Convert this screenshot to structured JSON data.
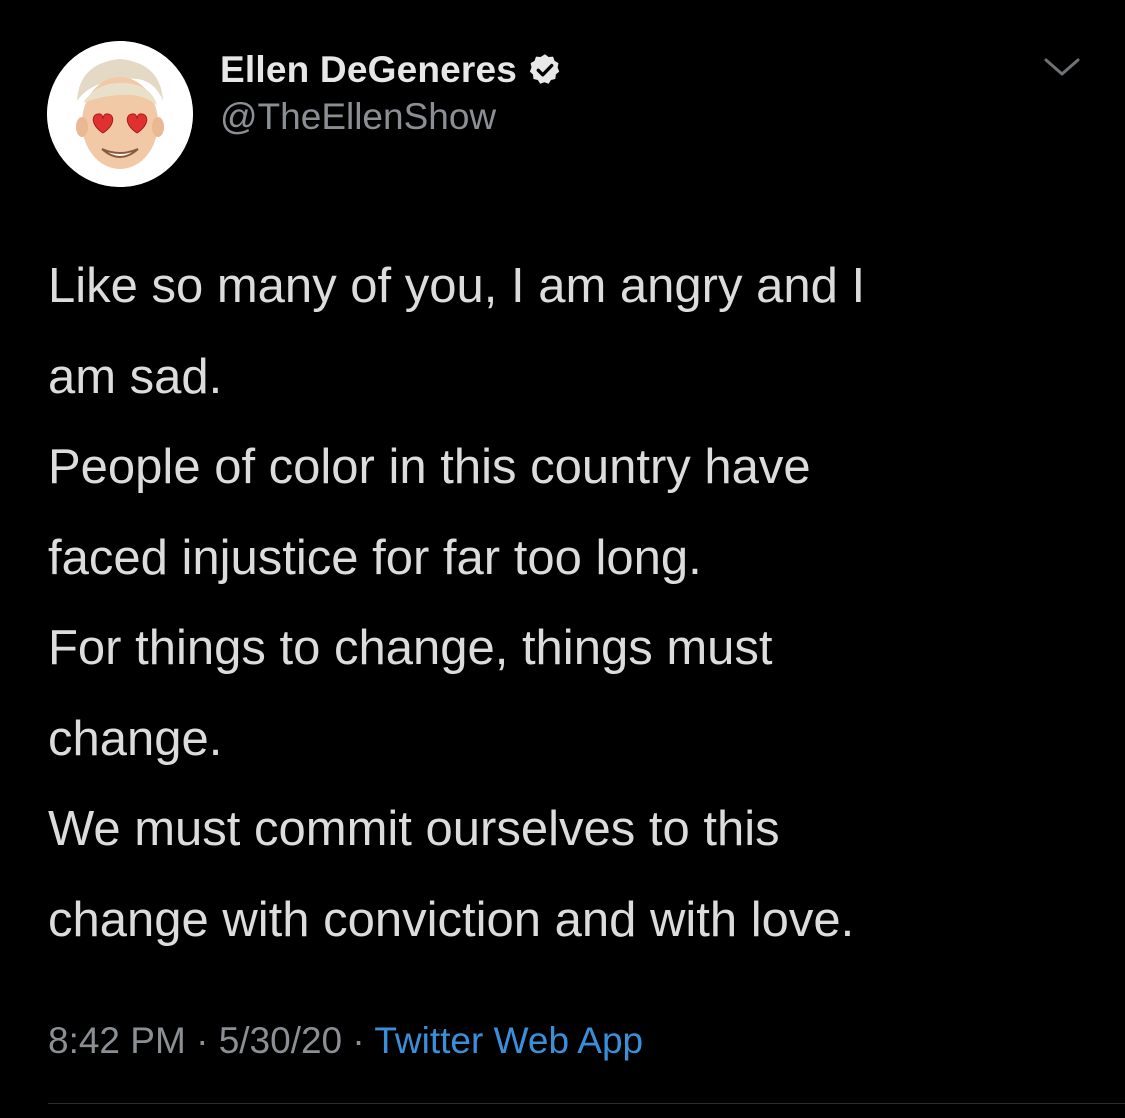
{
  "tweet": {
    "author": {
      "display_name": "Ellen DeGeneres",
      "handle": "@TheEllenShow",
      "verified_icon": "verified-badge-icon"
    },
    "menu_icon": "chevron-down-icon",
    "text_lines": [
      "Like so many of you, I am angry and I",
      "am sad.",
      "People of color in this country have",
      "faced injustice for far too long.",
      "For things to change, things must",
      "change.",
      "We must commit ourselves to this",
      "change with conviction and with love."
    ],
    "meta": {
      "time": "8:42 PM",
      "separator": "·",
      "date": "5/30/20",
      "source": "Twitter Web App"
    }
  },
  "colors": {
    "background": "#000000",
    "text": "#dcdcdc",
    "muted": "#8b8f94",
    "link": "#3a8fd8"
  }
}
